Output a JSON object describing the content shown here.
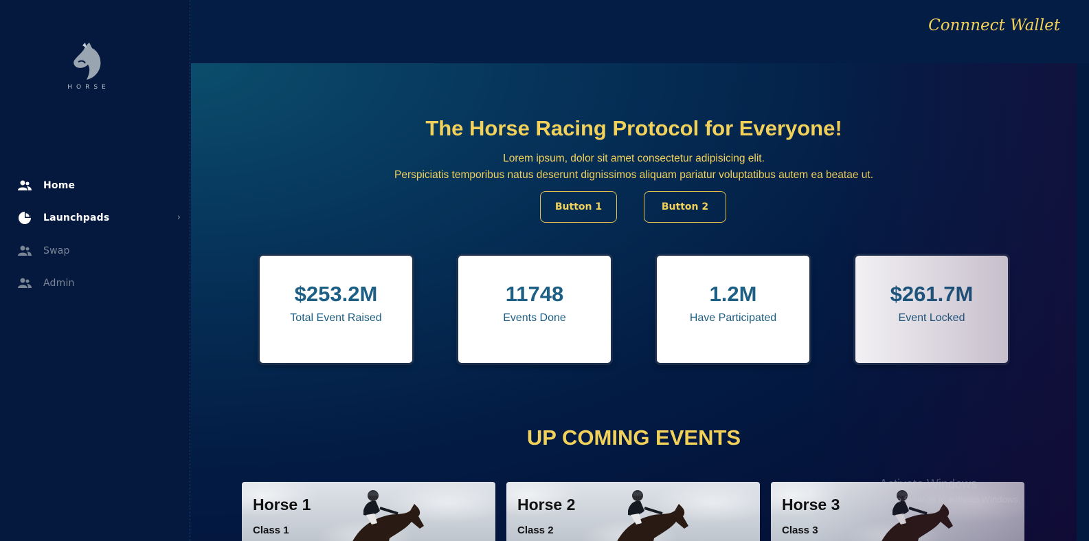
{
  "brand": {
    "name": "HORSE",
    "logo_icon": "horse-head-icon"
  },
  "sidebar": {
    "items": [
      {
        "label": "Home",
        "icon": "users-icon",
        "state": "active"
      },
      {
        "label": "Launchpads",
        "icon": "pie-chart-icon",
        "state": "active",
        "has_submenu": true
      },
      {
        "label": "Swap",
        "icon": "users-icon",
        "state": "muted"
      },
      {
        "label": "Admin",
        "icon": "users-icon",
        "state": "muted"
      }
    ]
  },
  "header": {
    "wallet_label": "Connnect Wallet"
  },
  "hero": {
    "title": "The Horse Racing Protocol for Everyone!",
    "subtitle_line1": "Lorem ipsum, dolor sit amet consectetur adipisicing elit.",
    "subtitle_line2": "Perspiciatis temporibus natus deserunt dignissimos aliquam pariatur voluptatibus autem ea beatae ut.",
    "button1": "Button 1",
    "button2": "Button 2"
  },
  "stats": [
    {
      "value": "$253.2M",
      "label": "Total Event Raised"
    },
    {
      "value": "11748",
      "label": "Events Done"
    },
    {
      "value": "1.2M",
      "label": "Have Participated"
    },
    {
      "value": "$261.7M",
      "label": "Event Locked"
    }
  ],
  "events": {
    "title": "UP COMING EVENTS",
    "items": [
      {
        "name": "Horse 1",
        "class": "Class 1"
      },
      {
        "name": "Horse 2",
        "class": "Class 2"
      },
      {
        "name": "Horse 3",
        "class": "Class 3"
      }
    ]
  },
  "system": {
    "activation_title": "Activate Windows",
    "activation_sub": "Go to Settings to activate Windows."
  },
  "colors": {
    "accent": "#f2d15a",
    "sidebar_bg": "#04193d",
    "stat_text": "#1d5f85"
  }
}
